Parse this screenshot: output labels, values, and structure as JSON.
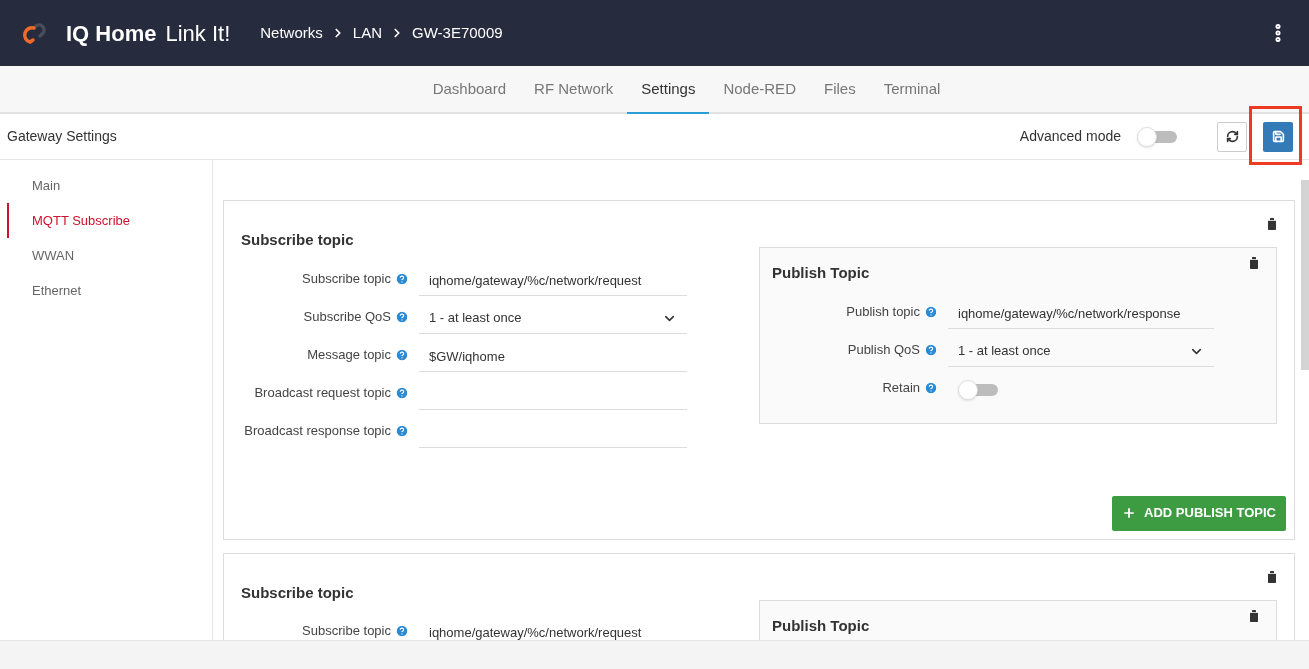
{
  "header": {
    "brand": "IQ Home",
    "product": "Link It!",
    "breadcrumbs": [
      "Networks",
      "LAN",
      "GW-3E70009"
    ]
  },
  "tabs": [
    {
      "label": "Dashboard",
      "selected": false
    },
    {
      "label": "RF Network",
      "selected": false
    },
    {
      "label": "Settings",
      "selected": true
    },
    {
      "label": "Node-RED",
      "selected": false
    },
    {
      "label": "Files",
      "selected": false
    },
    {
      "label": "Terminal",
      "selected": false
    }
  ],
  "toolbar": {
    "title": "Gateway Settings",
    "advanced_mode": {
      "label": "Advanced mode",
      "on": false
    },
    "save_highlighted": true
  },
  "sidebar": {
    "items": [
      {
        "label": "Main",
        "selected": false
      },
      {
        "label": "MQTT Subscribe",
        "selected": true
      },
      {
        "label": "WWAN",
        "selected": false
      },
      {
        "label": "Ethernet",
        "selected": false
      }
    ]
  },
  "cards": [
    {
      "title": "Subscribe topic",
      "fields": [
        {
          "kind": "text",
          "label": "Subscribe topic",
          "value": "iqhome/gateway/%c/network/request"
        },
        {
          "kind": "select",
          "label": "Subscribe QoS",
          "value": "1 - at least once"
        },
        {
          "kind": "text",
          "label": "Message topic",
          "value": "$GW/iqhome"
        },
        {
          "kind": "text",
          "label": "Broadcast request topic"
        },
        {
          "kind": "text",
          "label": "Broadcast response topic"
        }
      ],
      "publish": {
        "title": "Publish Topic",
        "fields": [
          {
            "kind": "text",
            "label": "Publish topic",
            "value": "iqhome/gateway/%c/network/response"
          },
          {
            "kind": "select",
            "label": "Publish QoS",
            "value": "1 - at least once"
          },
          {
            "kind": "toggle",
            "label": "Retain",
            "on": false
          }
        ]
      },
      "add_button": "ADD PUBLISH TOPIC"
    },
    {
      "title": "Subscribe topic",
      "fields": [
        {
          "kind": "text",
          "label": "Subscribe topic",
          "value": "iqhome/gateway/%c/network/request"
        }
      ],
      "publish": {
        "title": "Publish Topic"
      }
    }
  ]
}
